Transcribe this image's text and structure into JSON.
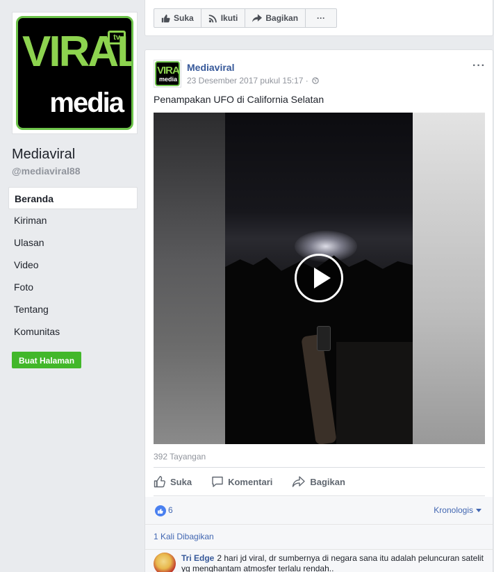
{
  "page": {
    "logo": {
      "word1": "VIRAL",
      "badge": "tv",
      "word2": "media"
    },
    "name": "Mediaviral",
    "handle": "@mediaviral88"
  },
  "nav": {
    "items": [
      {
        "label": "Beranda",
        "active": true
      },
      {
        "label": "Kiriman"
      },
      {
        "label": "Ulasan"
      },
      {
        "label": "Video"
      },
      {
        "label": "Foto"
      },
      {
        "label": "Tentang"
      },
      {
        "label": "Komunitas"
      }
    ],
    "create_label": "Buat Halaman"
  },
  "toolbar": {
    "like_label": "Suka",
    "follow_label": "Ikuti",
    "share_label": "Bagikan",
    "more_label": "···"
  },
  "post": {
    "author": "Mediaviral",
    "timestamp": "23 Desember 2017 pukul 15:17 ·",
    "more_label": "···",
    "text": "Penampakan UFO di California Selatan",
    "views": "392 Tayangan",
    "actions": {
      "like_label": "Suka",
      "comment_label": "Komentari",
      "share_label": "Bagikan"
    },
    "reactions_count": "6",
    "sort_label": "Kronologis",
    "shares": "1 Kali Dibagikan",
    "comment": {
      "author": "Tri Edge",
      "text": "2 hari jd viral, dr sumbernya di negara sana itu adalah peluncuran satelit yg menghantam atmosfer terlalu rendah.."
    }
  },
  "colors": {
    "link": "#365899",
    "accent": "#4267b2",
    "create_button": "#42b72a",
    "logo_green": "#8dd34f"
  }
}
